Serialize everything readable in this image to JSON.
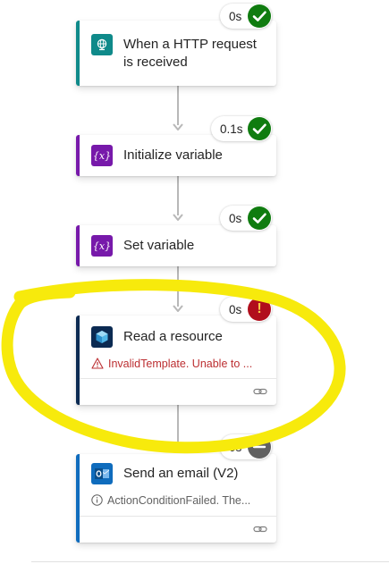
{
  "colors": {
    "http_trigger": "#0f8a8a",
    "variable": "#7719aa",
    "arm": "#0b2a52",
    "outlook": "#0f6cbd",
    "success": "#107c10",
    "failed": "#b10e1c",
    "skipped": "#616161",
    "error_text": "#bc2f32",
    "highlight": "#f7ea0c"
  },
  "steps": [
    {
      "title": "When a HTTP request is received",
      "duration": "0s",
      "status": "success",
      "icon": "http-globe-icon"
    },
    {
      "title": "Initialize variable",
      "duration": "0.1s",
      "status": "success",
      "icon": "variable-icon"
    },
    {
      "title": "Set variable",
      "duration": "0s",
      "status": "success",
      "icon": "variable-icon"
    },
    {
      "title": "Read a resource",
      "duration": "0s",
      "status": "failed",
      "icon": "azure-resource-manager-icon",
      "message": "InvalidTemplate. Unable to ...",
      "message_icon": "warning-icon"
    },
    {
      "title": "Send an email (V2)",
      "duration": "0s",
      "status": "skipped",
      "icon": "outlook-icon",
      "message": "ActionConditionFailed. The...",
      "message_icon": "info-icon"
    }
  ],
  "icon_glyphs": {
    "variable": "{x}",
    "failed": "!"
  }
}
